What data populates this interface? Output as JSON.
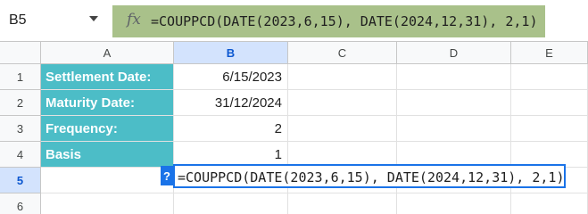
{
  "name_box": {
    "value": "B5"
  },
  "formula_bar": {
    "fx_label": "fx",
    "formula": "=COUPPCD(DATE(2023,6,15), DATE(2024,12,31), 2,1)"
  },
  "columns": [
    "A",
    "B",
    "C",
    "D",
    "E"
  ],
  "selected_column": "B",
  "rows": [
    "1",
    "2",
    "3",
    "4",
    "5",
    "6"
  ],
  "selected_row": "5",
  "cells": {
    "A1": "Settlement Date:",
    "B1": "6/15/2023",
    "A2": "Maturity Date:",
    "B2": "31/12/2024",
    "A3": "Frequency:",
    "B3": "2",
    "A4": "Basis",
    "B4": "1"
  },
  "editor": {
    "help_label": "?",
    "formula": "=COUPPCD(DATE(2023,6,15), DATE(2024,12,31), 2,1)"
  },
  "colors": {
    "label_fill": "#4cbdc7",
    "formula_bar_fill": "#a9c18a",
    "selection_blue": "#1a73e8",
    "header_selected": "#d3e3fd"
  }
}
